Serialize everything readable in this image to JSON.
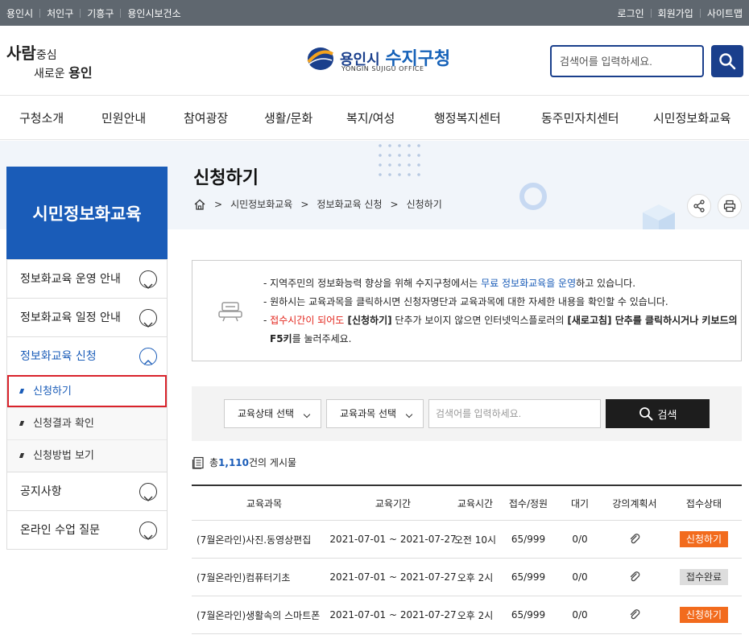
{
  "topbar": {
    "left_links": [
      "용인시",
      "처인구",
      "기흥구",
      "용인시보건소"
    ],
    "right_links": [
      "로그인",
      "회원가입",
      "사이트맵"
    ]
  },
  "header": {
    "slogan_line1_big": "사람",
    "slogan_line1_rest": "중심",
    "slogan_line2_rest": "새로운",
    "slogan_line2_big": "용인",
    "logo_city": "용인시",
    "logo_office": "수지구청",
    "logo_en": "YONGIN SUJIGU OFFICE",
    "search_placeholder": "검색어를 입력하세요.",
    "colors": {
      "brand": "#1a3f8c",
      "accent": "#1a5cb8"
    }
  },
  "gnb": [
    "구청소개",
    "민원안내",
    "참여광장",
    "생활/문화",
    "복지/여성",
    "행정복지센터",
    "동주민자치센터",
    "시민정보화교육"
  ],
  "lnb": {
    "title": "시민정보화교육",
    "menu": [
      {
        "label": "정보화교육 운영 안내"
      },
      {
        "label": "정보화교육 일정 안내"
      },
      {
        "label": "정보화교육 신청",
        "sub": [
          "신청하기",
          "신청결과 확인",
          "신청방법 보기"
        ]
      },
      {
        "label": "공지사항"
      },
      {
        "label": "온라인 수업 질문"
      }
    ]
  },
  "page": {
    "title": "신청하기",
    "breadcrumb": [
      "시민정보화교육",
      "정보화교육 신청",
      "신청하기"
    ]
  },
  "info": {
    "l1_a": "- 지역주민의 정보화능력 향상을 위해 수지구청에서는 ",
    "l1_b": "무료 정보화교육을 운영",
    "l1_c": "하고 있습니다.",
    "l2": "- 원하시는 교육과목을 클릭하시면 신청자명단과 교육과목에 대한 자세한 내용을 확인할 수 있습니다.",
    "l3_dash": "- ",
    "l3_a": "접수시간이 되어도",
    "l3_b": " [신청하기]",
    "l3_c": " 단추가 보이지 않으면 인터넷익스플로러의 ",
    "l3_d": "[새로고침] 단추를 클릭하시거나 키보드의",
    "l4_a": "F5키",
    "l4_b": "를 눌러주세요."
  },
  "search": {
    "status_select": "교육상태 선택",
    "course_select": "교육과목 선택",
    "placeholder": "검색어를 입력하세요.",
    "button": "검색"
  },
  "total": {
    "prefix": "총 ",
    "count": "1,110",
    "suffix": "건의 게시물"
  },
  "table": {
    "headers": [
      "교육과목",
      "교육기간",
      "교육시간",
      "접수/정원",
      "대기",
      "강의계획서",
      "접수상태"
    ],
    "rows": [
      {
        "course": "(7월온라인)사진.동영상편집",
        "period": "2021-07-01 ~ 2021-07-27",
        "time": "오전 10시",
        "quota": "65/999",
        "wait": "0/0",
        "status": "신청하기"
      },
      {
        "course": "(7월온라인)컴퓨터기초",
        "period": "2021-07-01 ~ 2021-07-27",
        "time": "오후 2시",
        "quota": "65/999",
        "wait": "0/0",
        "status": "접수완료"
      },
      {
        "course": "(7월온라인)생활속의 스마트폰",
        "period": "2021-07-01 ~ 2021-07-27",
        "time": "오후 2시",
        "quota": "65/999",
        "wait": "0/0",
        "status": "신청하기"
      }
    ]
  }
}
